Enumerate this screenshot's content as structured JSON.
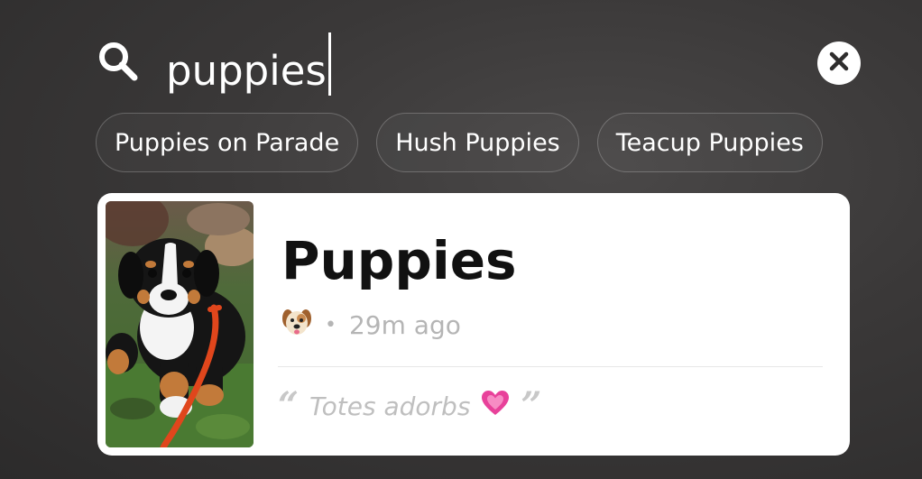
{
  "search": {
    "query": "puppies"
  },
  "icons": {
    "search": "search-icon",
    "clear": "close-icon",
    "emoji_dog": "dog-face-emoji",
    "emoji_heart": "growing-heart-emoji"
  },
  "suggestions": [
    {
      "label": "Puppies on Parade"
    },
    {
      "label": "Hush Puppies"
    },
    {
      "label": "Teacup Puppies"
    }
  ],
  "result": {
    "title": "Puppies",
    "time_ago": "29m ago",
    "quote": "Totes adorbs",
    "open_quote": "“",
    "close_quote": "”"
  },
  "colors": {
    "background": "#333232",
    "card": "#ffffff",
    "heart": "#e8419a",
    "leash": "#e0461c"
  }
}
